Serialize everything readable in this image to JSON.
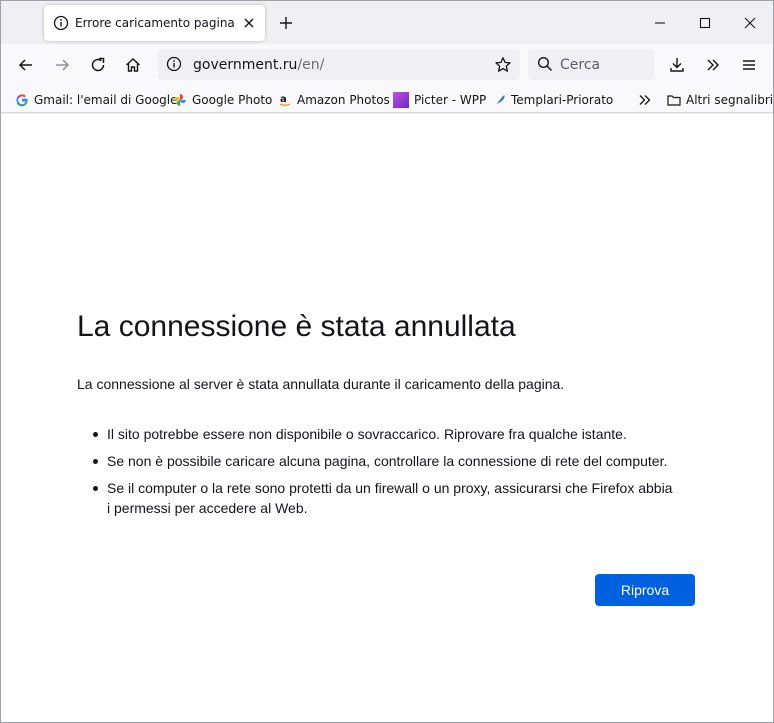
{
  "browser": {
    "tab": {
      "title": "Errore caricamento pagina"
    },
    "url": {
      "host": "government.ru",
      "path": "/en/"
    },
    "search": {
      "placeholder": "Cerca"
    },
    "bookmarks": [
      {
        "label": "Gmail: l'email di Google",
        "icon": "google-icon"
      },
      {
        "label": "Google Photo",
        "icon": "google-photos-icon"
      },
      {
        "label": "Amazon Photos",
        "icon": "amazon-icon"
      },
      {
        "label": "Picter - WPP",
        "icon": "picter-icon"
      },
      {
        "label": "Templari-Priorato",
        "icon": "feather-icon"
      }
    ],
    "other_bookmarks": {
      "label": "Altri segnalibri",
      "icon": "folder-icon"
    }
  },
  "error": {
    "title": "La connessione è stata annullata",
    "description": "La connessione al server è stata annullata durante il caricamento della pagina.",
    "tips": [
      "Il sito potrebbe essere non disponibile o sovraccarico. Riprovare fra qualche istante.",
      "Se non è possibile caricare alcuna pagina, controllare la connessione di rete del computer.",
      "Se il computer o la rete sono protetti da un firewall o un proxy, assicurarsi che Firefox abbia i permessi per accedere al Web."
    ],
    "retry_label": "Riprova"
  },
  "colors": {
    "accent": "#0061e0",
    "text": "#15141a",
    "chrome": "#f0f0f4"
  }
}
